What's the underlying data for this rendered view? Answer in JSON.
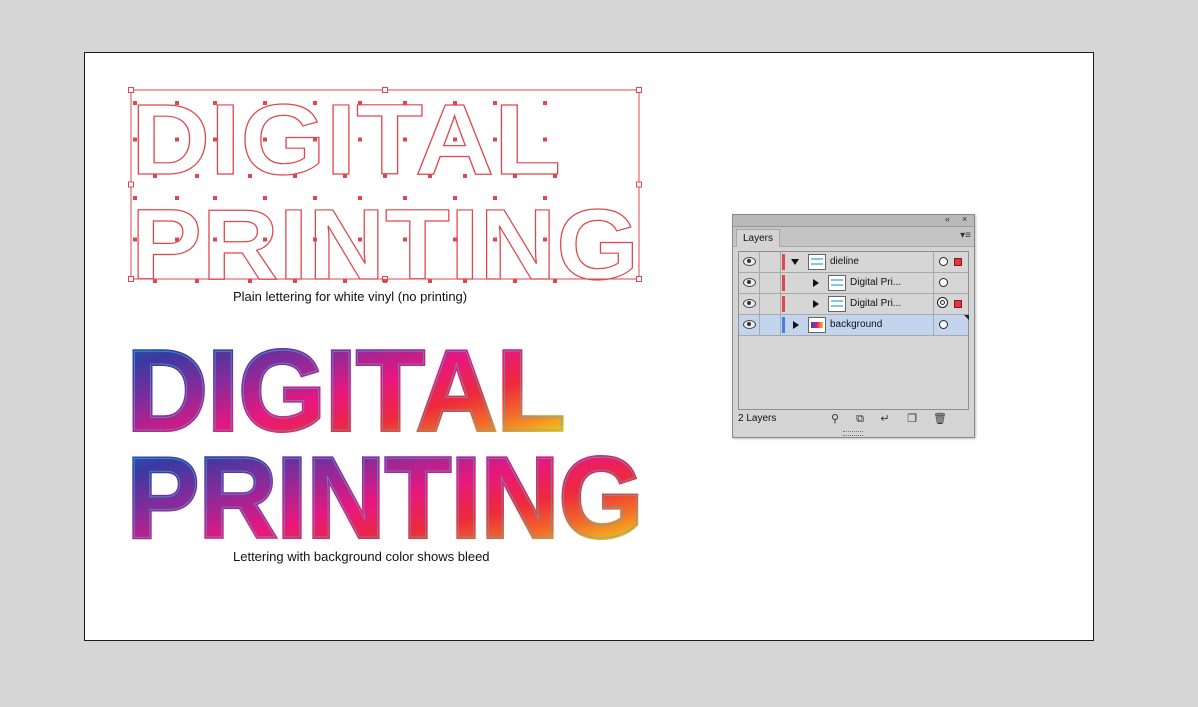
{
  "artwork": {
    "top_title": [
      "DIGITAL",
      "PRINTING"
    ],
    "bottom_title": [
      "DIGITAL",
      "PRINTING"
    ],
    "caption_top": "Plain lettering for white vinyl (no printing)",
    "caption_bottom": "Lettering with background color shows bleed",
    "colors": {
      "dieline": "#e0474c",
      "path_blue": "#6fa8dc",
      "gradient": [
        "#1e6bb8",
        "#3a3aa0",
        "#8a2a9a",
        "#e8177e",
        "#ee2a3a",
        "#f26a2a",
        "#f5c21b",
        "#f2ef2a"
      ],
      "inner_outline": "#2fb6e0"
    }
  },
  "layers_panel": {
    "tab_label": "Layers",
    "collapse_icon": "double-chevron-left-icon",
    "close_icon": "close-icon",
    "menu_icon": "panel-menu-icon",
    "rows": [
      {
        "name": "dieline",
        "expanded": true,
        "color": "#e0474c",
        "indent": 0,
        "selected": false,
        "has_selection": true,
        "target": "single"
      },
      {
        "name": "Digital Pri...",
        "expanded": false,
        "color": "#e0474c",
        "indent": 1,
        "selected": false,
        "has_selection": false,
        "target": "single"
      },
      {
        "name": "Digital Pri...",
        "expanded": false,
        "color": "#e0474c",
        "indent": 1,
        "selected": false,
        "has_selection": true,
        "target": "double"
      },
      {
        "name": "background",
        "expanded": false,
        "color": "#4a7be0",
        "indent": 0,
        "selected": true,
        "has_selection": false,
        "target": "single"
      }
    ],
    "footer": {
      "count": "2 Layers",
      "icons": [
        "locate-object-icon",
        "make-clipping-mask-icon",
        "create-sublayer-icon",
        "create-new-layer-icon",
        "delete-selection-icon"
      ]
    }
  }
}
